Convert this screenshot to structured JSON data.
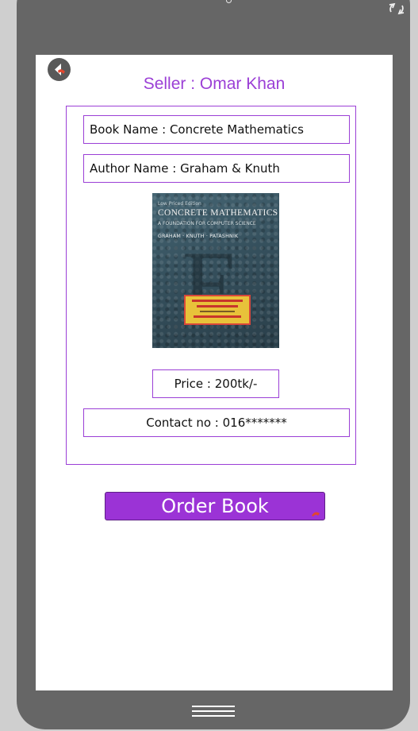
{
  "seller": {
    "label": "Seller : Omar Khan"
  },
  "book": {
    "name_label": "Book Name : Concrete Mathematics",
    "author_label": "Author Name : Graham & Knuth",
    "price_label": "Price : 200tk/-",
    "contact_label": "Contact no : 016*******"
  },
  "cover": {
    "edition": "Low Priced Edition",
    "title": "CONCRETE MATHEMATICS",
    "subtitle": "A FOUNDATION FOR COMPUTER SCIENCE",
    "authors": "GRAHAM · KNUTH · PATASHNIK",
    "letter": "E"
  },
  "actions": {
    "order_label": "Order Book"
  },
  "icons": {
    "back": "back-arrow-icon",
    "rotate": "rotate-icon",
    "home": "home-bar-icon",
    "order_corner": "corner-arrow-icon"
  },
  "colors": {
    "accent": "#9b33d6",
    "border": "#9b3fd6",
    "device": "#666666",
    "screen": "#ffffff"
  }
}
